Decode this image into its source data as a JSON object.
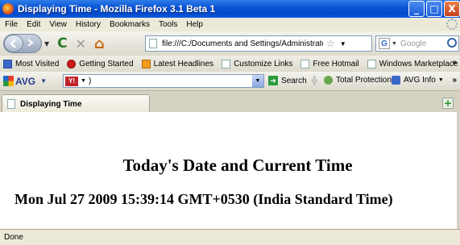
{
  "window": {
    "title": "Displaying Time - Mozilla Firefox 3.1 Beta 1",
    "controls": {
      "minimize": "_",
      "maximize": "□",
      "close": "X"
    }
  },
  "menu": [
    "File",
    "Edit",
    "View",
    "History",
    "Bookmarks",
    "Tools",
    "Help"
  ],
  "nav": {
    "reload_icon": "C",
    "stop_icon": "✕",
    "home_icon": "⌂",
    "url": "file:///C:/Documents and Settings/Administrator/M",
    "search_placeholder": "Google",
    "search_engine_icon": "G"
  },
  "bookmarks": {
    "items": [
      "Most Visited",
      "Getting Started",
      "Latest Headlines",
      "Customize Links",
      "Free Hotmail",
      "Windows Marketplace"
    ],
    "overflow": "»"
  },
  "avg_toolbar": {
    "logo": "AVG",
    "search_value": ")",
    "search_label": "Search",
    "protection_label": "Total Protection",
    "info_label": "AVG Info",
    "overflow": "»"
  },
  "tabs": [
    {
      "label": "Displaying Time"
    }
  ],
  "page": {
    "heading": "Today's Date and Current Time",
    "datetime": "Mon Jul 27 2009 15:39:14 GMT+0530 (India Standard Time)"
  },
  "status": {
    "text": "Done"
  },
  "colors": {
    "titlebar": "#0a56d6",
    "chrome": "#ece9d8",
    "background": "#f7dfa6"
  }
}
